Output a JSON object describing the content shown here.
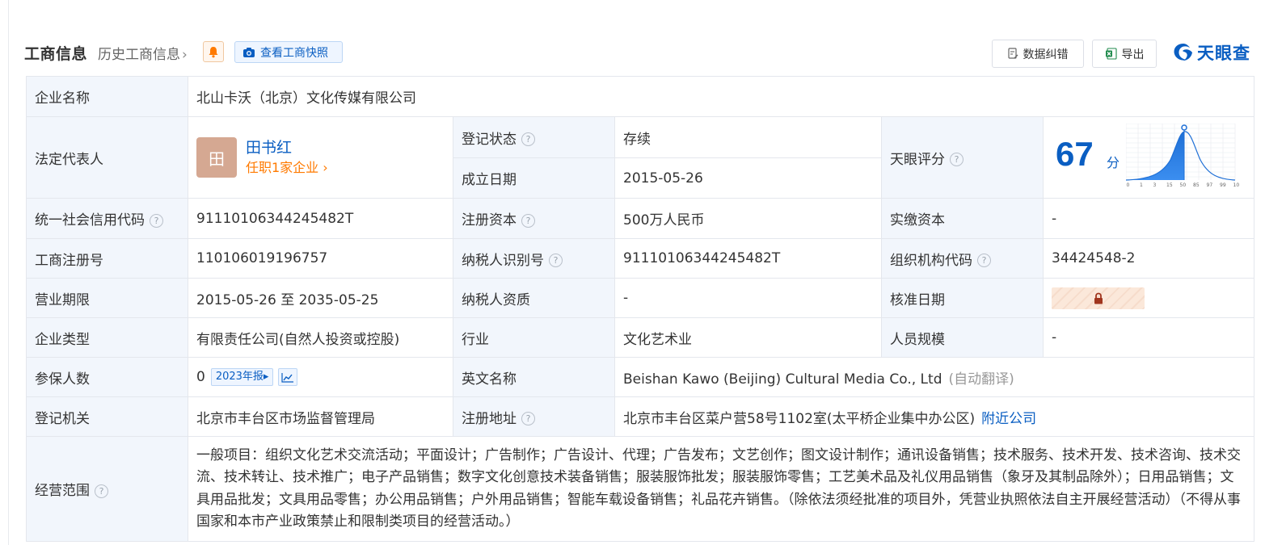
{
  "header": {
    "title": "工商信息",
    "history_link": "历史工商信息",
    "snapshot_button": "查看工商快照",
    "feedback_button": "数据纠错",
    "export_button": "导出",
    "logo_text": "天眼查"
  },
  "colors": {
    "brand_blue": "#0a5ec2",
    "status_green": "#1a9a5a",
    "accent_orange": "#ff7a00",
    "label_bg": "#f2f6fc"
  },
  "company": {
    "name_label": "企业名称",
    "name_value": "北山卡沃（北京）文化传媒有限公司",
    "legal_rep_label": "法定代表人",
    "legal_rep_avatar": "田",
    "legal_rep_name": "田书红",
    "legal_rep_sub": "任职1家企业",
    "reg_status_label": "登记状态",
    "reg_status_value": "存续",
    "found_date_label": "成立日期",
    "found_date_value": "2015-05-26",
    "score_label": "天眼评分",
    "score_value": "67",
    "score_unit": "分",
    "score_axis": [
      "0",
      "1",
      "3",
      "15",
      "50",
      "85",
      "97",
      "99",
      "100"
    ],
    "credit_code_label": "统一社会信用代码",
    "credit_code_value": "91110106344245482T",
    "reg_capital_label": "注册资本",
    "reg_capital_value": "500万人民币",
    "paid_capital_label": "实缴资本",
    "paid_capital_value": "-",
    "biz_reg_no_label": "工商注册号",
    "biz_reg_no_value": "110106019196757",
    "taxpayer_id_label": "纳税人识别号",
    "taxpayer_id_value": "91110106344245482T",
    "org_code_label": "组织机构代码",
    "org_code_value": "34424548-2",
    "term_label": "营业期限",
    "term_value": "2015-05-26 至 2035-05-25",
    "taxpayer_qual_label": "纳税人资质",
    "taxpayer_qual_value": "-",
    "approve_date_label": "核准日期",
    "type_label": "企业类型",
    "type_value": "有限责任公司(自然人投资或控股)",
    "industry_label": "行业",
    "industry_value": "文化艺术业",
    "staff_size_label": "人员规模",
    "staff_size_value": "-",
    "insured_label": "参保人数",
    "insured_value": "0",
    "insured_year_badge": "2023年报",
    "english_name_label": "英文名称",
    "english_name_value": "Beishan Kawo (Beijing) Cultural Media Co., Ltd",
    "english_name_note": "(自动翻译)",
    "authority_label": "登记机关",
    "authority_value": "北京市丰台区市场监督管理局",
    "address_label": "注册地址",
    "address_value": "北京市丰台区菜户营58号1102室(太平桥企业集中办公区)",
    "address_link": "附近公司",
    "scope_label": "经营范围",
    "scope_value": "一般项目：组织文化艺术交流活动；平面设计；广告制作；广告设计、代理；广告发布；文艺创作；图文设计制作；通讯设备销售；技术服务、技术开发、技术咨询、技术交流、技术转让、技术推广；电子产品销售；数字文化创意技术装备销售；服装服饰批发；服装服饰零售；工艺美术品及礼仪用品销售（象牙及其制品除外）；日用品销售；文具用品批发；文具用品零售；办公用品销售；户外用品销售；智能车载设备销售；礼品花卉销售。（除依法须经批准的项目外，凭营业执照依法自主开展经营活动）（不得从事国家和本市产业政策禁止和限制类项目的经营活动。）"
  }
}
